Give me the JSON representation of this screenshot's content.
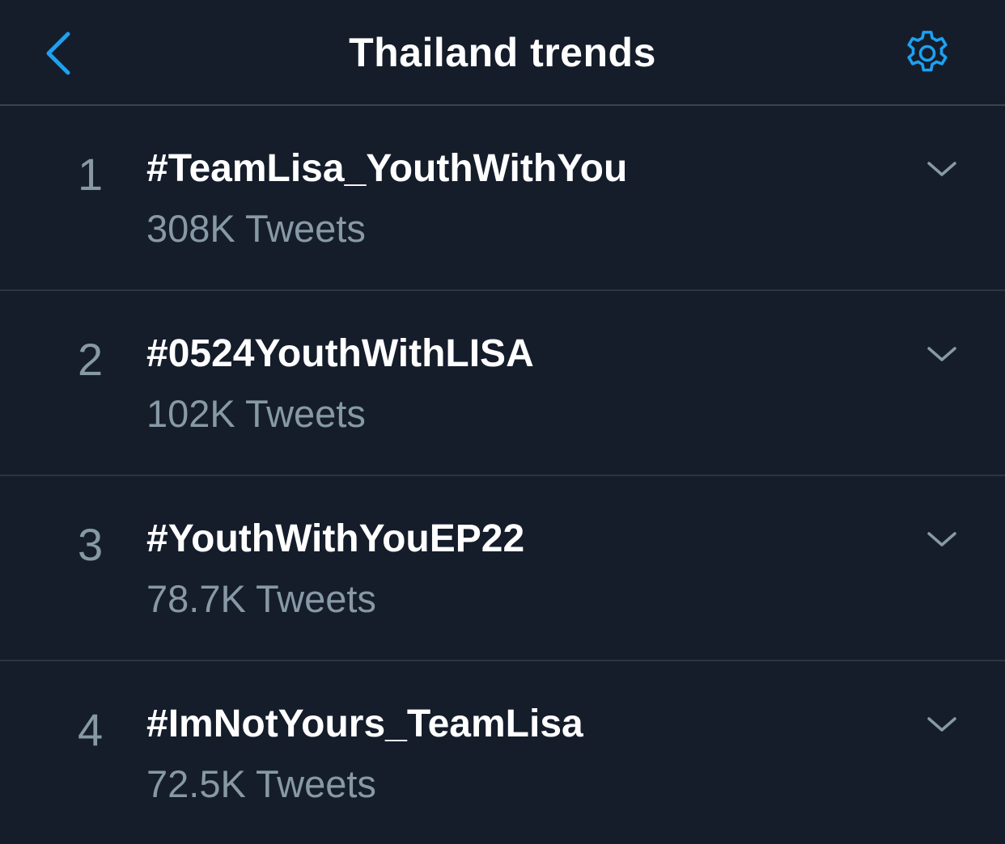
{
  "header": {
    "title": "Thailand trends",
    "back_icon": "chevron-left-icon",
    "settings_icon": "gear-icon"
  },
  "colors": {
    "background": "#151d2b",
    "accent": "#1da1f2",
    "primary_text": "#ffffff",
    "secondary_text": "#8899a6",
    "divider": "#38444d"
  },
  "trends": [
    {
      "rank": "1",
      "name": "#TeamLisa_YouthWithYou",
      "count": "308K Tweets"
    },
    {
      "rank": "2",
      "name": "#0524YouthWithLISA",
      "count": "102K Tweets"
    },
    {
      "rank": "3",
      "name": "#YouthWithYouEP22",
      "count": "78.7K Tweets"
    },
    {
      "rank": "4",
      "name": "#ImNotYours_TeamLisa",
      "count": "72.5K Tweets"
    }
  ]
}
